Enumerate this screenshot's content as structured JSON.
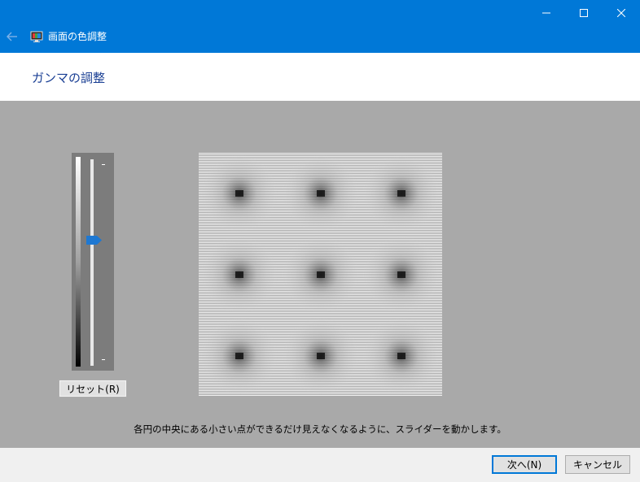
{
  "window": {
    "title": "画面の色調整",
    "controls": [
      "minimize",
      "maximize",
      "close"
    ]
  },
  "header": {
    "title": "ガンマの調整"
  },
  "slider": {
    "reset_label": "リセット(R)",
    "value_fraction": 0.6,
    "accent_color": "#1e78d2"
  },
  "instruction": "各円の中央にある小さい点ができるだけ見えなくなるように、スライダーを動かします。",
  "footer": {
    "next_label": "次へ(N)",
    "cancel_label": "キャンセル"
  },
  "colors": {
    "titlebar": "#0078d7",
    "content_bg": "#a9a9a9",
    "title_text": "#1a3f94"
  },
  "icons": [
    "back-arrow-icon",
    "display-color-icon",
    "minimize-icon",
    "maximize-icon",
    "close-icon",
    "slider-thumb-icon"
  ]
}
